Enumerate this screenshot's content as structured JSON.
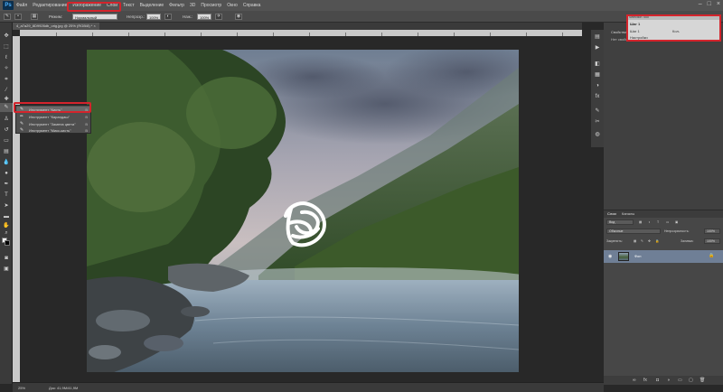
{
  "app": {
    "logo": "Ps",
    "menu": [
      "Файл",
      "Редактирование",
      "Изображение",
      "Слои",
      "Текст",
      "Выделение",
      "Фильтр",
      "3D",
      "Просмотр",
      "Окно",
      "Справка"
    ],
    "window_controls": [
      "–",
      "□",
      "×"
    ]
  },
  "options": {
    "mode_label": "Режим:",
    "mode_value": "Нормальный",
    "opacity_label": "Непрозр.:",
    "opacity_value": "100%",
    "flow_label": "Наж.:",
    "flow_value": "100%"
  },
  "document": {
    "tab_label": "4_a7a29_8D9926db_orig.jpg @ 25% (RGB/8) *"
  },
  "flyout": {
    "items": [
      {
        "label": "Инструмент \"Кисть\"",
        "key": "B"
      },
      {
        "label": "Инструмент \"Карандаш\"",
        "key": "B"
      },
      {
        "label": "Инструмент \"Замена цвета\"",
        "key": "B"
      },
      {
        "label": "Инструмент \"Микс-кисть\"",
        "key": "B"
      }
    ]
  },
  "properties": {
    "title": "Свойства",
    "subtitle": "Нет свойств"
  },
  "float_panel": {
    "title": "Selection Tool",
    "heading": "Шаг 1",
    "line1": "Шаг 1",
    "line2": "Настройки",
    "value": "Кол-"
  },
  "layers": {
    "tabs": [
      "Слои",
      "Каналы"
    ],
    "kind_label": "Вид",
    "blend_mode": "Обычные",
    "opacity_label": "Непрозрачность:",
    "opacity_value": "100%",
    "lock_label": "Закрепить:",
    "fill_label": "Заливка:",
    "fill_value": "100%",
    "layer_name": "Фон",
    "footer_icons": [
      "link-icon",
      "fx-icon",
      "mask-icon",
      "adjustment-icon",
      "folder-icon",
      "new-layer-icon",
      "trash-icon"
    ]
  },
  "status": {
    "zoom": "25%",
    "doc_info": "Док: 41,9M/41,9M"
  },
  "colors": {
    "highlight": "#d4242c",
    "foreground": "#ffffff",
    "background": "#000000"
  }
}
